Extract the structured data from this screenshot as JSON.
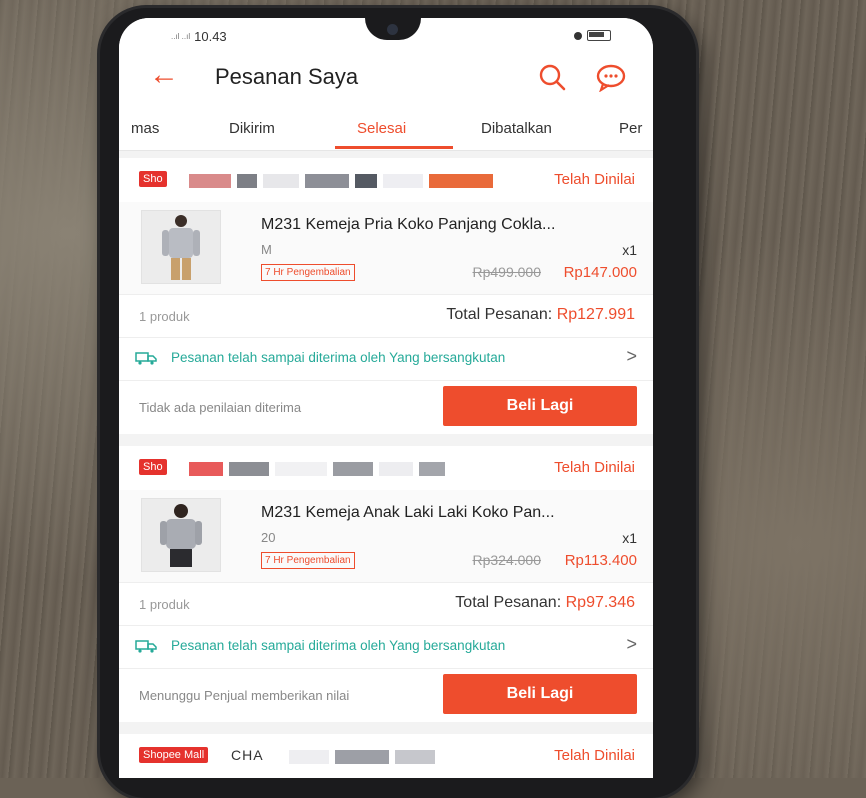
{
  "statusbar": {
    "time": "10.43",
    "signal": "..ıl ..ıl"
  },
  "header": {
    "title": "Pesanan Saya"
  },
  "tabs": [
    {
      "label": "mas",
      "active": false
    },
    {
      "label": "Dikirim",
      "active": false
    },
    {
      "label": "Selesai",
      "active": true
    },
    {
      "label": "Dibatalkan",
      "active": false
    },
    {
      "label": "Per",
      "active": false
    }
  ],
  "orders": [
    {
      "shop_badge": "Sho",
      "rating_status": "Telah Dinilai",
      "product_name": "M231 Kemeja Pria Koko Panjang Cokla...",
      "variant": "M",
      "quantity": "x1",
      "return_badge": "7 Hr Pengembalian",
      "original_price": "Rp499.000",
      "price": "Rp147.000",
      "item_count": "1 produk",
      "total_label": "Total Pesanan:",
      "total_value": "Rp127.991",
      "shipping_status": "Pesanan telah sampai diterima oleh Yang bersangkutan",
      "note": "Tidak ada penilaian diterima",
      "button_label": "Beli Lagi"
    },
    {
      "shop_badge": "Sho",
      "rating_status": "Telah Dinilai",
      "product_name": "M231 Kemeja Anak Laki Laki Koko Pan...",
      "variant": "20",
      "quantity": "x1",
      "return_badge": "7 Hr Pengembalian",
      "original_price": "Rp324.000",
      "price": "Rp113.400",
      "item_count": "1 produk",
      "total_label": "Total Pesanan:",
      "total_value": "Rp97.346",
      "shipping_status": "Pesanan telah sampai diterima oleh Yang bersangkutan",
      "note": "Menunggu Penjual memberikan nilai",
      "button_label": "Beli Lagi"
    },
    {
      "shop_badge": "Shopee Mall",
      "shop_name_partial": "CHA",
      "rating_status": "Telah Dinilai"
    }
  ],
  "colors": {
    "accent": "#ee4d2d",
    "shipping": "#26aa99"
  }
}
